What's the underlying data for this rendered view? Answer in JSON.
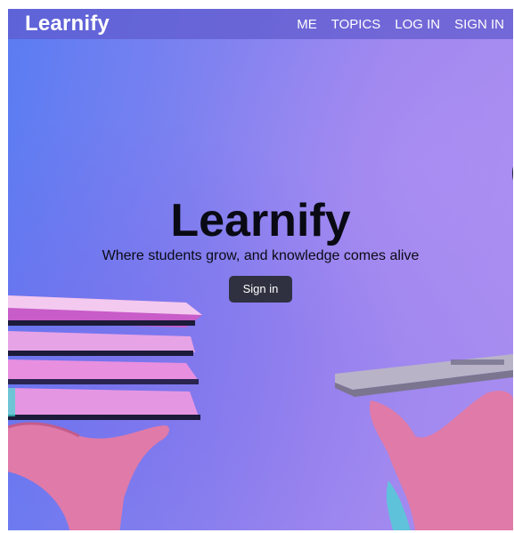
{
  "navbar": {
    "brand": "Learnify",
    "links": [
      "ME",
      "TOPICS",
      "LOG IN",
      "SIGN IN"
    ]
  },
  "hero": {
    "title": "Learnify",
    "subtitle": "Where students grow, and knowledge comes alive",
    "cta_label": "Sign in"
  },
  "colors": {
    "navbar_bg": "#605acd",
    "gradient_left": "#5a7cf2",
    "gradient_right": "#a98df0",
    "button_bg": "#2f3140",
    "title_text": "#0a0a14"
  },
  "images": {
    "left": "hand-holding-books",
    "right": "hand-holding-laptop"
  }
}
